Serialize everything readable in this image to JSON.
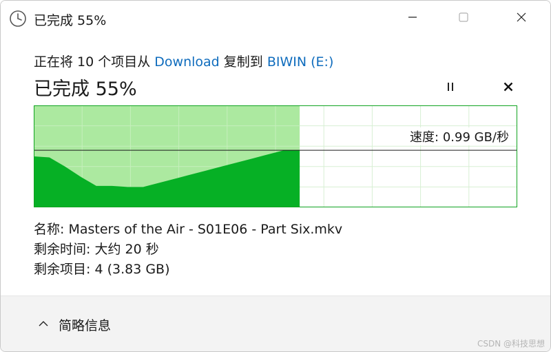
{
  "window": {
    "title": "已完成 55%",
    "icon": "clock-icon"
  },
  "copy": {
    "prefix": "正在将 10 个项目从 ",
    "source": "Download",
    "middle": " 复制到 ",
    "destination": "BIWIN (E:)",
    "percent_label": "已完成 55%",
    "progress_fraction": 0.55
  },
  "controls": {
    "pause_icon": "pause-icon",
    "cancel_icon": "close-icon"
  },
  "chart_data": {
    "type": "area",
    "progress": 0.55,
    "speed_label": "速度: 0.99 GB/秒",
    "current_speed_fraction": 0.56,
    "throughput_profile": [
      0.5,
      0.49,
      0.4,
      0.3,
      0.21,
      0.21,
      0.2,
      0.2,
      0.24,
      0.28,
      0.32,
      0.36,
      0.4,
      0.44,
      0.48,
      0.52,
      0.56,
      0.56
    ],
    "colors": {
      "progress_fill": "#a8e89b",
      "throughput_fill": "#06b025",
      "border": "#0fa31f",
      "grid": "#d7efd3",
      "speed_line": "#1a1a1a"
    }
  },
  "details": {
    "name_label": "名称: ",
    "name_value": "Masters of the Air - S01E06 - Part Six.mkv",
    "time_label": "剩余时间: ",
    "time_value": "大约 20 秒",
    "items_label": "剩余项目: ",
    "items_value": "4 (3.83 GB)"
  },
  "footer": {
    "toggle_label": "简略信息",
    "toggle_icon": "chevron-up-icon",
    "watermark": "CSDN @科技思想"
  }
}
